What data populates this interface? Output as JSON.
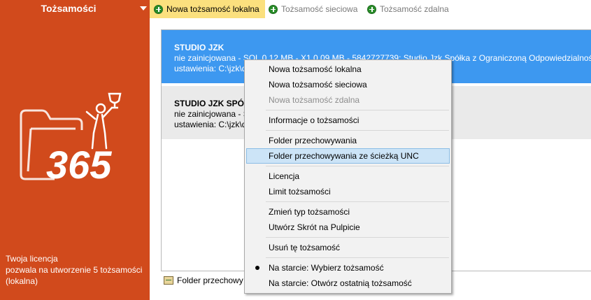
{
  "sidebar": {
    "title": "Tożsamości",
    "license_line1": "Twoja licencja",
    "license_line2": "pozwala na utworzenie 5 tożsamości",
    "license_line3": "(lokalna)",
    "logo_text": "365",
    "color": "#d14a1c"
  },
  "toolbar": {
    "new_local": "Nowa tożsamość lokalna",
    "new_network": "Tożsamość sieciowa",
    "new_remote": "Tożsamość zdalna",
    "active_color": "#fbe07e"
  },
  "identities": [
    {
      "name": "STUDIO JZK",
      "details": "nie zainicjowana - SQL 0.12 MB - X1 0.09 MB - 5842727739: Studio Jzk Spółka z Ograniczoną Odpowiedzialnością",
      "settings": "ustawienia: C:\\jzk\\d"
    },
    {
      "name": "STUDIO JZK SPÓŁ",
      "details": "nie zainicjowana - S",
      "settings": "ustawienia: C:\\jzk\\d"
    }
  ],
  "bottom": {
    "folder_label": "Folder przechowy"
  },
  "context_menu": {
    "new_local": "Nowa tożsamość lokalna",
    "new_network": "Nowa tożsamość sieciowa",
    "new_remote": "Nowa tożsamość zdalna",
    "info": "Informacje o tożsamości",
    "storage_folder": "Folder przechowywania",
    "storage_folder_unc": "Folder przechowywania ze ścieżką UNC",
    "license": "Licencja",
    "limit": "Limit tożsamości",
    "change_type": "Zmień typ tożsamości",
    "shortcut": "Utwórz Skrót na Pulpicie",
    "delete": "Usuń tę tożsamość",
    "startup_choose": "Na starcie: Wybierz tożsamość",
    "startup_last": "Na starcie: Otwórz ostatnią tożsamość"
  }
}
